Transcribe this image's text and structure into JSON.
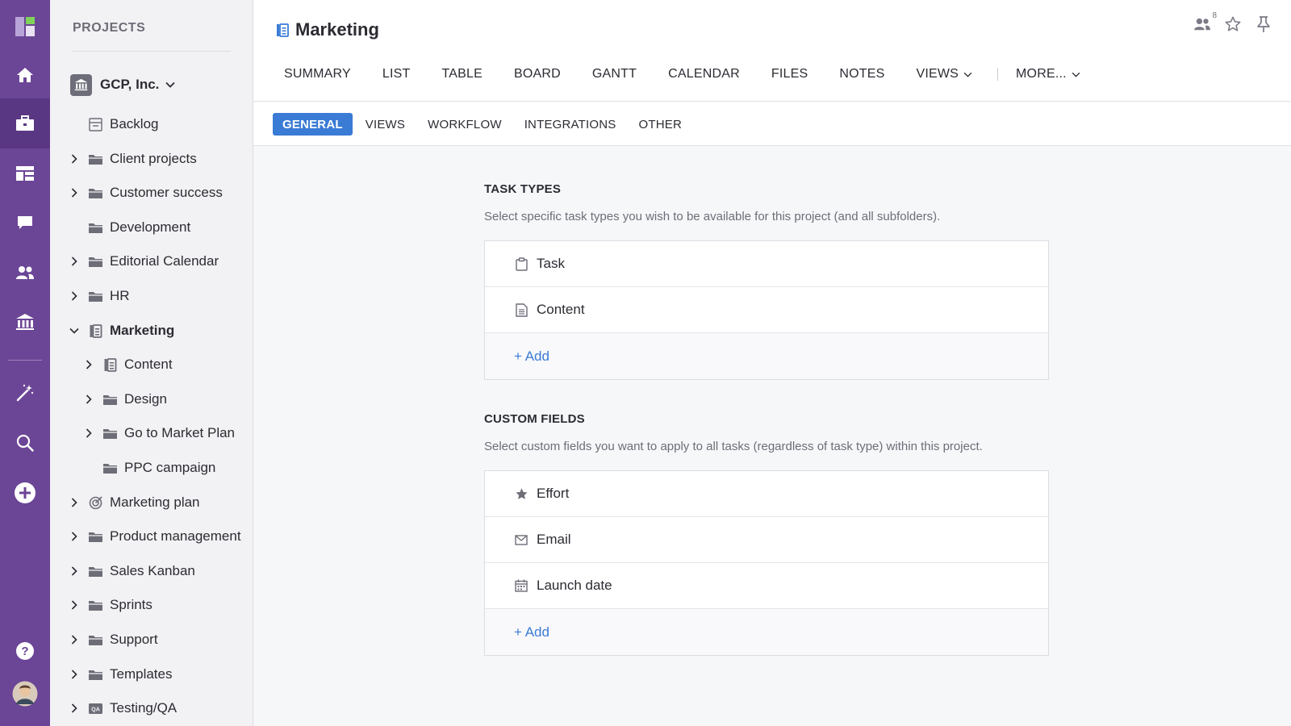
{
  "colors": {
    "rail": "#6b4596",
    "rail_active": "#5a3783",
    "accent": "#3a7bd5"
  },
  "rail": {
    "items": [
      {
        "icon": "logo-icon"
      },
      {
        "icon": "home-icon"
      },
      {
        "icon": "briefcase-icon",
        "active": true
      },
      {
        "icon": "dashboard-icon"
      },
      {
        "icon": "chat-icon"
      },
      {
        "icon": "team-icon"
      },
      {
        "icon": "bank-icon"
      },
      {
        "icon": "magic-wand-icon"
      },
      {
        "icon": "search-icon"
      },
      {
        "icon": "plus-circle-icon"
      },
      {
        "icon": "help-icon"
      },
      {
        "icon": "avatar"
      }
    ]
  },
  "sidebar": {
    "title": "PROJECTS",
    "org": "GCP, Inc.",
    "items": [
      {
        "label": "Backlog",
        "icon": "backlog-icon",
        "expandable": false
      },
      {
        "label": "Client projects",
        "icon": "folder-icon",
        "expandable": true
      },
      {
        "label": "Customer success",
        "icon": "folder-icon",
        "expandable": true
      },
      {
        "label": "Development",
        "icon": "folder-icon",
        "expandable": false
      },
      {
        "label": "Editorial Calendar",
        "icon": "folder-icon",
        "expandable": true
      },
      {
        "label": "HR",
        "icon": "folder-icon",
        "expandable": true
      },
      {
        "label": "Marketing",
        "icon": "project-icon",
        "expandable": true,
        "expanded": true,
        "selected": true
      },
      {
        "label": "Content",
        "icon": "project-icon",
        "expandable": true
      },
      {
        "label": "Design",
        "icon": "folder-icon",
        "expandable": true
      },
      {
        "label": "Go to Market Plan",
        "icon": "folder-icon",
        "expandable": true
      },
      {
        "label": "PPC campaign",
        "icon": "folder-icon",
        "expandable": false
      },
      {
        "label": "Marketing plan",
        "icon": "target-icon",
        "expandable": true
      },
      {
        "label": "Product management",
        "icon": "folder-icon",
        "expandable": true
      },
      {
        "label": "Sales Kanban",
        "icon": "folder-icon",
        "expandable": true
      },
      {
        "label": "Sprints",
        "icon": "folder-icon",
        "expandable": true
      },
      {
        "label": "Support",
        "icon": "folder-icon",
        "expandable": true
      },
      {
        "label": "Templates",
        "icon": "folder-icon",
        "expandable": true
      },
      {
        "label": "Testing/QA",
        "icon": "qa-icon",
        "expandable": true
      }
    ]
  },
  "header": {
    "title": "Marketing",
    "members_count": "8",
    "tabs": [
      "SUMMARY",
      "LIST",
      "TABLE",
      "BOARD",
      "GANTT",
      "CALENDAR",
      "FILES",
      "NOTES",
      "VIEWS",
      "MORE..."
    ]
  },
  "subnav": {
    "tabs": [
      "GENERAL",
      "VIEWS",
      "WORKFLOW",
      "INTEGRATIONS",
      "OTHER"
    ],
    "active": "GENERAL"
  },
  "task_types": {
    "title": "TASK TYPES",
    "description": "Select specific task types you wish to be available for this project (and all subfolders).",
    "items": [
      {
        "label": "Task",
        "icon": "clipboard-icon"
      },
      {
        "label": "Content",
        "icon": "document-icon"
      }
    ],
    "add_label": "+ Add"
  },
  "custom_fields": {
    "title": "CUSTOM FIELDS",
    "description": "Select custom fields you want to apply to all tasks (regardless of task type) within this project.",
    "items": [
      {
        "label": "Effort",
        "icon": "star-icon"
      },
      {
        "label": "Email",
        "icon": "mail-icon"
      },
      {
        "label": "Launch date",
        "icon": "calendar-icon"
      }
    ],
    "add_label": "+ Add"
  }
}
